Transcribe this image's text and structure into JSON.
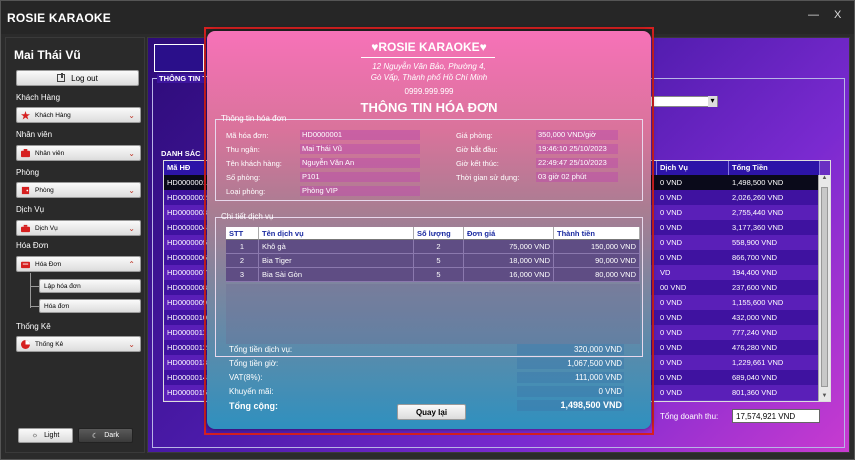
{
  "window": {
    "title": "ROSIE KARAOKE",
    "close_label": "X"
  },
  "sidebar": {
    "user_name": "Mai Thái Vũ",
    "logout_label": "Log out",
    "sections": [
      {
        "label": "Khách Hàng",
        "combo": "Khách Hàng",
        "icon": "person-star-icon"
      },
      {
        "label": "Nhân viên",
        "combo": "Nhân viên",
        "icon": "staff-icon"
      },
      {
        "label": "Phòng",
        "combo": "Phòng",
        "icon": "room-icon"
      },
      {
        "label": "Dịch Vụ",
        "combo": "Dịch Vụ",
        "icon": "service-icon"
      },
      {
        "label": "Hóa Đơn",
        "combo": "Hóa Đơn",
        "icon": "invoice-icon"
      },
      {
        "label": "Thống Kê",
        "combo": "Thống Kê",
        "icon": "pie-chart-icon"
      }
    ],
    "invoice_subitems": [
      "Lập hóa đơn",
      "Hóa đơn"
    ],
    "theme_light": "Light",
    "theme_dark": "Dark"
  },
  "main": {
    "section_info": "THÔNG TIN T",
    "section_list": "DANH SÁC",
    "table": {
      "headers": [
        "Mã HĐ",
        "",
        "",
        "",
        "",
        "Dịch Vụ",
        "Tổng Tiền"
      ],
      "rows": [
        {
          "id": "HD0000001",
          "svc": "0 VND",
          "total": "1,498,500 VND"
        },
        {
          "id": "HD0000002",
          "svc": "0 VND",
          "total": "2,026,260 VND"
        },
        {
          "id": "HD0000003",
          "svc": "0 VND",
          "total": "2,755,440 VND"
        },
        {
          "id": "HD0000004",
          "svc": "0 VND",
          "total": "3,177,360 VND"
        },
        {
          "id": "HD0000005",
          "svc": "0 VND",
          "total": "558,900 VND"
        },
        {
          "id": "HD0000006",
          "svc": "0 VND",
          "total": "866,700 VND"
        },
        {
          "id": "HD0000007",
          "svc": "VD",
          "total": "194,400 VND"
        },
        {
          "id": "HD0000008",
          "svc": "00 VND",
          "total": "237,600 VND"
        },
        {
          "id": "HD0000009",
          "svc": "0 VND",
          "total": "1,155,600 VND"
        },
        {
          "id": "HD0000010",
          "svc": "0 VND",
          "total": "432,000 VND"
        },
        {
          "id": "HD0000011",
          "svc": "0 VND",
          "total": "777,240 VND"
        },
        {
          "id": "HD0000012",
          "svc": "0 VND",
          "total": "476,280 VND"
        },
        {
          "id": "HD0000013",
          "svc": "0 VND",
          "total": "1,229,661 VND"
        },
        {
          "id": "HD0000014",
          "svc": "0 VND",
          "total": "689,040 VND"
        },
        {
          "id": "HD0000015",
          "svc": "0 VND",
          "total": "801,360 VND"
        }
      ]
    },
    "revenue_label": "Tổng doanh thu:",
    "revenue_value": "17,574,921 VND"
  },
  "dialog": {
    "brand": "♥ROSIE KARAOKE♥",
    "address_line1": "12 Nguyễn Văn Bảo, Phường 4,",
    "address_line2": "Gò Vấp, Thành phố Hồ Chí Minh",
    "phone": "0999.999.999",
    "title": "THÔNG TIN HÓA ĐƠN",
    "info_group_title": "Thông tin hóa đơn",
    "info": {
      "invoice_id_label": "Mã hóa đơn:",
      "invoice_id": "HD0000001",
      "cashier_label": "Thu ngân:",
      "cashier": "Mai Thái Vũ",
      "customer_label": "Tên khách hàng:",
      "customer": "Nguyễn Văn An",
      "room_label": "Số phòng:",
      "room": "P101",
      "room_type_label": "Loại phòng:",
      "room_type": "Phòng VIP",
      "room_price_label": "Giá phòng:",
      "room_price": "350,000 VND/giờ",
      "start_label": "Giờ bắt đầu:",
      "start": "19:46:10 25/10/2023",
      "end_label": "Giờ kết thúc:",
      "end": "22:49:47 25/10/2023",
      "duration_label": "Thời gian sử dụng:",
      "duration": "03 giờ 02 phút"
    },
    "service_group_title": "Chi tiết dịch vụ",
    "service_table": {
      "headers": [
        "STT",
        "Tên dịch vụ",
        "Số lượng",
        "Đơn giá",
        "Thành tiền"
      ],
      "rows": [
        [
          "1",
          "Khô gà",
          "2",
          "75,000 VND",
          "150,000 VND"
        ],
        [
          "2",
          "Bia Tiger",
          "5",
          "18,000 VND",
          "90,000 VND"
        ],
        [
          "3",
          "Bia Sài Gòn",
          "5",
          "16,000 VND",
          "80,000 VND"
        ]
      ]
    },
    "summary": {
      "service_total_label": "Tổng tiền dịch vụ:",
      "service_total": "320,000 VND",
      "time_total_label": "Tổng tiền giờ:",
      "time_total": "1,067,500 VND",
      "vat_label": "VAT(8%):",
      "vat": "111,000 VND",
      "discount_label": "Khuyến mãi:",
      "discount": "0 VND",
      "grand_total_label": "Tổng cộng:",
      "grand_total": "1,498,500 VND"
    },
    "back_label": "Quay lại"
  }
}
